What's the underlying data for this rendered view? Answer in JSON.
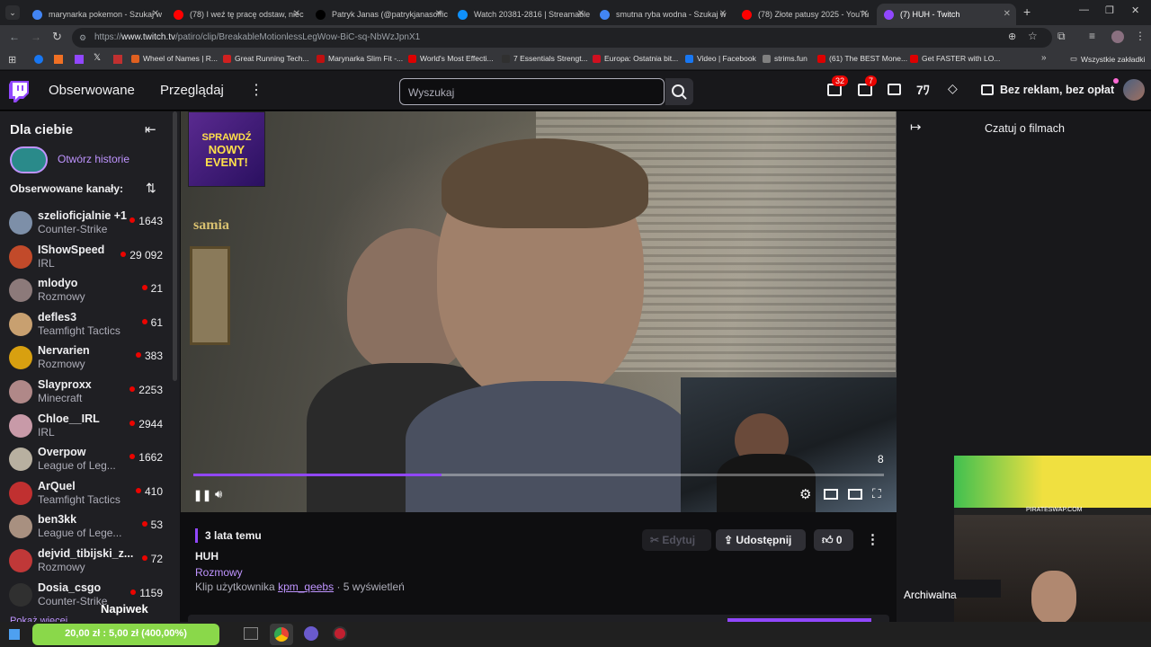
{
  "browser": {
    "tabs": [
      {
        "title": "marynarka pokemon - Szukaj w",
        "color": "#4285f4"
      },
      {
        "title": "(78) I weź tę pracę odstaw, niec",
        "color": "#ff0000"
      },
      {
        "title": "Patryk Janas (@patrykjanasoffic",
        "color": "#000000"
      },
      {
        "title": "Watch 20381-2816 | Streamable",
        "color": "#0f90fa"
      },
      {
        "title": "smutna ryba wodna - Szukaj w",
        "color": "#4285f4"
      },
      {
        "title": "(78) Złote patusy 2025 - YouTu",
        "color": "#ff0000"
      },
      {
        "title": "(7) HUH - Twitch",
        "color": "#9147ff"
      }
    ],
    "url_prefix": "https://",
    "url_domain": "www.twitch.tv",
    "url_path": "/patiro/clip/BreakableMotionlessLegWow-BiC-sq-NbWzJpnX1",
    "bookmarks": [
      "Wheel of Names | R...",
      "Great Running Tech...",
      "Marynarka Slim Fit -...",
      "World's Most Effecti...",
      "7 Essentials Strengt...",
      "Europa: Ostatnia bit...",
      "Video | Facebook",
      "strims.fun",
      "(61) The BEST Mone...",
      "Get FASTER with LO..."
    ],
    "all_bookmarks": "Wszystkie zakładki"
  },
  "nav": {
    "following": "Obserwowane",
    "browse": "Przeglądaj",
    "search_placeholder": "Wyszukaj",
    "notifications_count": "32",
    "inbox_count": "7",
    "ad_free": "Bez reklam, bez opłat"
  },
  "sidebar": {
    "for_you": "Dla ciebie",
    "open_stories": "Otwórz historie",
    "followed_header": "Obserwowane kanały:",
    "channels": [
      {
        "name": "szelioficjalnie +1",
        "game": "Counter-Strike",
        "viewers": "1643",
        "color": "#7d8fa8"
      },
      {
        "name": "IShowSpeed",
        "game": "IRL",
        "viewers": "29 092",
        "color": "#c24a2a"
      },
      {
        "name": "mlodyo",
        "game": "Rozmowy",
        "viewers": "21",
        "color": "#8c7a7a"
      },
      {
        "name": "defles3",
        "game": "Teamfight Tactics",
        "viewers": "61",
        "color": "#c8a070"
      },
      {
        "name": "Nervarien",
        "game": "Rozmowy",
        "viewers": "383",
        "color": "#d8a010"
      },
      {
        "name": "Slayproxx",
        "game": "Minecraft",
        "viewers": "2253",
        "color": "#b08888"
      },
      {
        "name": "Chloe__IRL",
        "game": "IRL",
        "viewers": "2944",
        "color": "#c89aa8"
      },
      {
        "name": "Overpow",
        "game": "League of Leg...",
        "viewers": "1662",
        "color": "#b8b0a0"
      },
      {
        "name": "ArQuel",
        "game": "Teamfight Tactics",
        "viewers": "410",
        "color": "#c03030"
      },
      {
        "name": "ben3kk",
        "game": "League of Lege...",
        "viewers": "53",
        "color": "#a89080"
      },
      {
        "name": "dejvid_tibijski_z...",
        "game": "Rozmowy",
        "viewers": "72",
        "color": "#c03838"
      },
      {
        "name": "Dosia_csgo",
        "game": "Counter-Strike",
        "viewers": "1159",
        "color": "#303030"
      }
    ],
    "show_more": "Pokaż więcej",
    "tip_label": "Napiwek",
    "tip_amount": "20,00 zł : 5,00 zł (400,00%)",
    "tip_progress": 1.0
  },
  "video": {
    "promo_line1": "SPRAWDŹ",
    "promo_line2": "NOWY",
    "promo_line3": "EVENT!",
    "watermark": "samia",
    "cam_number": "8",
    "progress": 0.36
  },
  "clip": {
    "age": "3 lata temu",
    "title": "HUH",
    "category": "Rozmowy",
    "clip_by_prefix": "Klip użytkownika",
    "clip_by_user": "kpm_qeebs",
    "views": "5 wyświetleń",
    "edit": "Edytuj",
    "share": "Udostępnij",
    "likes": "0"
  },
  "chat": {
    "title": "Czatuj o filmach",
    "archive": "Archiwalna"
  },
  "overlay": {
    "site_label": "PIRATESWAP.COM"
  }
}
